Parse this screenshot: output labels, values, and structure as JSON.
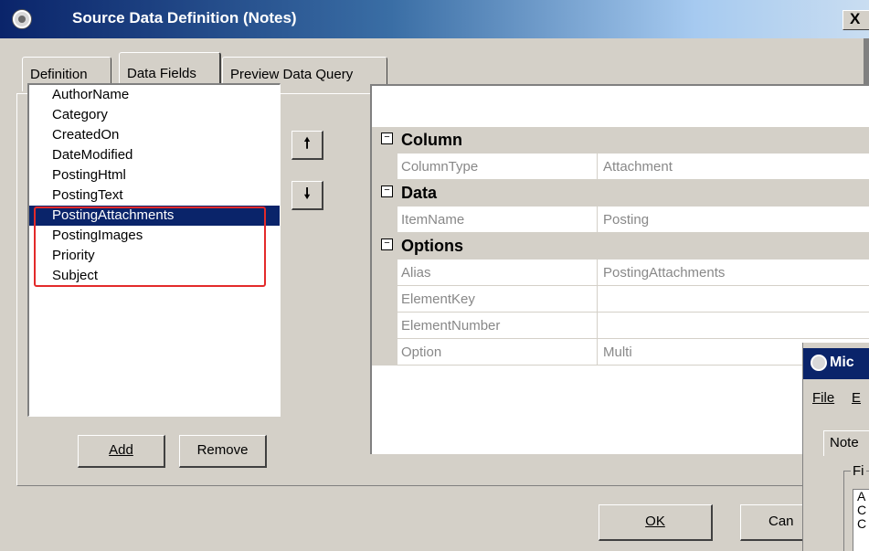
{
  "window": {
    "title": "Source Data Definition (Notes)",
    "close_label": "X"
  },
  "tabs": [
    {
      "label": "Definition"
    },
    {
      "label": "Data Fields"
    },
    {
      "label": "Preview Data Query"
    }
  ],
  "active_tab": "Data Fields",
  "fields": {
    "items": [
      "AuthorName",
      "Category",
      "CreatedOn",
      "DateModified",
      "PostingHtml",
      "PostingText",
      "PostingAttachments",
      "PostingImages",
      "Priority",
      "Subject"
    ],
    "selected": "PostingAttachments",
    "move_up_icon": "arrow-up-icon",
    "move_down_icon": "arrow-down-icon",
    "add_label": "Add",
    "remove_label": "Remove"
  },
  "properties": {
    "categories": [
      {
        "name": "Column",
        "rows": [
          {
            "name": "ColumnType",
            "value": "Attachment"
          }
        ]
      },
      {
        "name": "Data",
        "rows": [
          {
            "name": "ItemName",
            "value": "Posting"
          }
        ]
      },
      {
        "name": "Options",
        "rows": [
          {
            "name": "Alias",
            "value": "PostingAttachments"
          },
          {
            "name": "ElementKey",
            "value": ""
          },
          {
            "name": "ElementNumber",
            "value": ""
          },
          {
            "name": "Option",
            "value": "Multi"
          }
        ]
      }
    ]
  },
  "footer": {
    "ok_label": "OK",
    "cancel_label": "Can"
  },
  "background_window": {
    "title": "Mic",
    "menu": [
      "File",
      "E"
    ],
    "tab": "Note",
    "group_label": "Fi",
    "list": [
      "A",
      "C",
      "C"
    ]
  },
  "colors": {
    "highlight_box": "#e32a2a",
    "selection": "#0a246a",
    "titlebar": "#0a246a"
  }
}
